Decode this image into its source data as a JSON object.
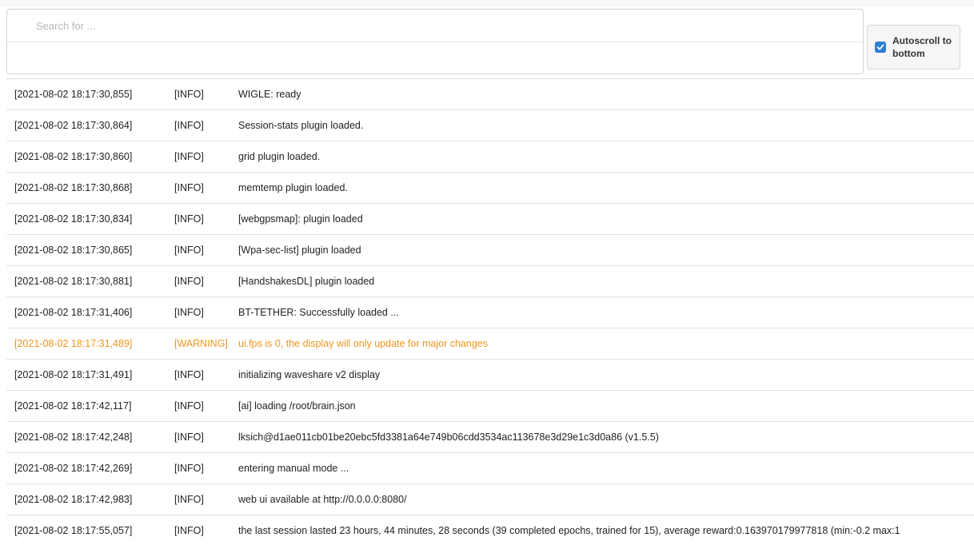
{
  "search": {
    "placeholder": "Search for ..."
  },
  "autoscroll": {
    "label": "Autoscroll to bottom",
    "checked": true
  },
  "colors": {
    "checkbox": "#2f7dd6",
    "warning_text": "#f0961e"
  },
  "log_rows": [
    {
      "timestamp": "[2021-08-02 18:17:30,855]",
      "level": "[INFO]",
      "message": "WIGLE: ready"
    },
    {
      "timestamp": "[2021-08-02 18:17:30,864]",
      "level": "[INFO]",
      "message": "Session-stats plugin loaded."
    },
    {
      "timestamp": "[2021-08-02 18:17:30,860]",
      "level": "[INFO]",
      "message": "grid plugin loaded."
    },
    {
      "timestamp": "[2021-08-02 18:17:30,868]",
      "level": "[INFO]",
      "message": "memtemp plugin loaded."
    },
    {
      "timestamp": "[2021-08-02 18:17:30,834]",
      "level": "[INFO]",
      "message": "[webgpsmap]: plugin loaded"
    },
    {
      "timestamp": "[2021-08-02 18:17:30,865]",
      "level": "[INFO]",
      "message": "[Wpa-sec-list] plugin loaded"
    },
    {
      "timestamp": "[2021-08-02 18:17:30,881]",
      "level": "[INFO]",
      "message": "[HandshakesDL] plugin loaded"
    },
    {
      "timestamp": "[2021-08-02 18:17:31,406]",
      "level": "[INFO]",
      "message": "BT-TETHER: Successfully loaded ..."
    },
    {
      "timestamp": "[2021-08-02 18:17:31,489]",
      "level": "[WARNING]",
      "message": "ui.fps is 0, the display will only update for major changes"
    },
    {
      "timestamp": "[2021-08-02 18:17:31,491]",
      "level": "[INFO]",
      "message": "initializing waveshare v2 display"
    },
    {
      "timestamp": "[2021-08-02 18:17:42,117]",
      "level": "[INFO]",
      "message": "[ai] loading /root/brain.json"
    },
    {
      "timestamp": "[2021-08-02 18:17:42,248]",
      "level": "[INFO]",
      "message": "lksich@d1ae011cb01be20ebc5fd3381a64e749b06cdd3534ac113678e3d29e1c3d0a86 (v1.5.5)"
    },
    {
      "timestamp": "[2021-08-02 18:17:42,269]",
      "level": "[INFO]",
      "message": "entering manual mode ..."
    },
    {
      "timestamp": "[2021-08-02 18:17:42,983]",
      "level": "[INFO]",
      "message": "web ui available at http://0.0.0.0:8080/"
    },
    {
      "timestamp": "[2021-08-02 18:17:55,057]",
      "level": "[INFO]",
      "message": "the last session lasted 23 hours, 44 minutes, 28 seconds (39 completed epochs, trained for 15), average reward:0.163970179977818 (min:-0.2 max:1"
    }
  ]
}
